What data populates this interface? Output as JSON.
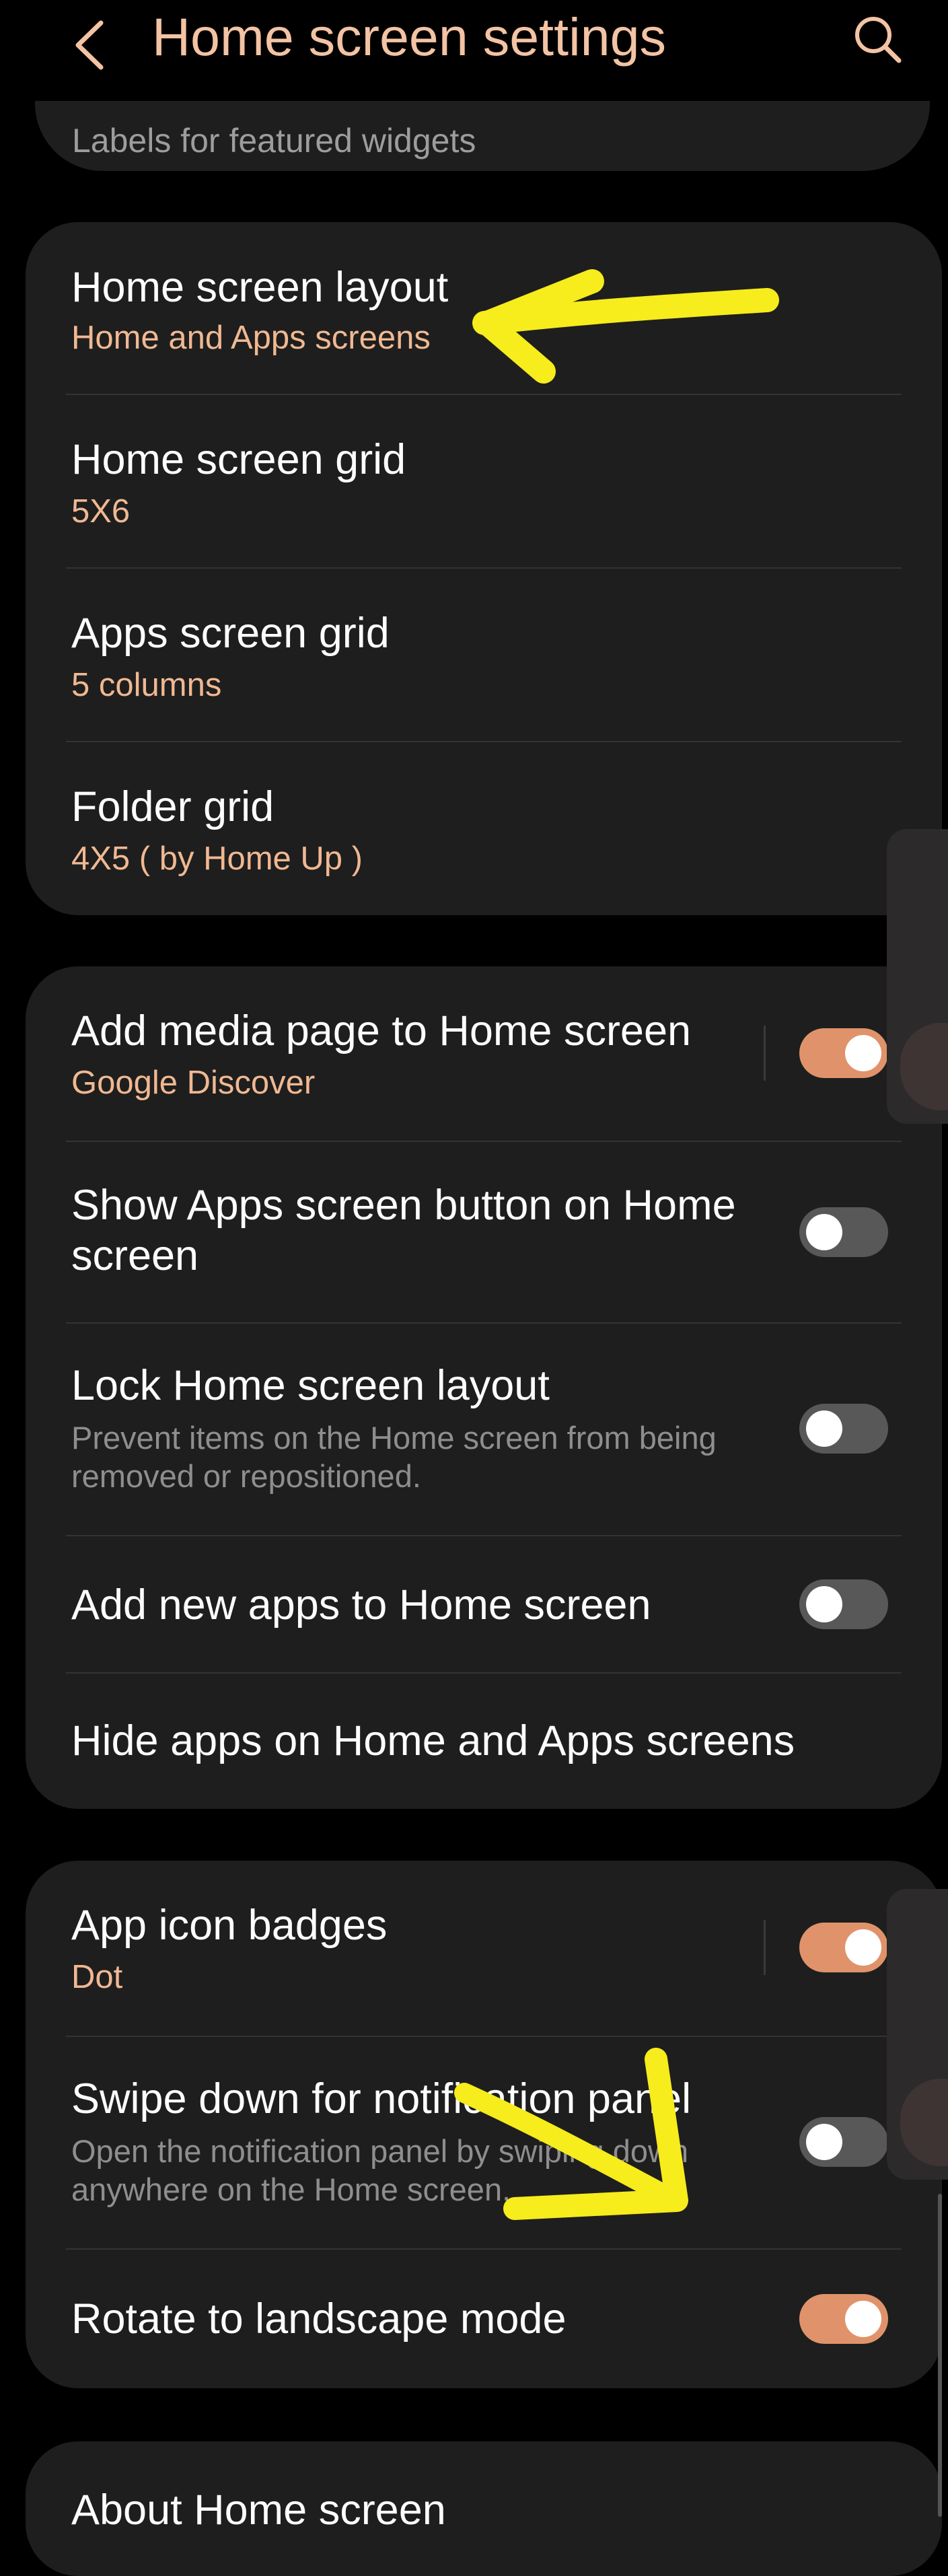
{
  "header": {
    "title": "Home screen settings",
    "back_icon": "chevron-left-icon",
    "search_icon": "search-icon"
  },
  "previous_card": {
    "label": "Labels for featured widgets"
  },
  "layout_group": {
    "home_layout": {
      "title": "Home screen layout",
      "value": "Home and Apps screens"
    },
    "home_grid": {
      "title": "Home screen grid",
      "value": "5X6"
    },
    "apps_grid": {
      "title": "Apps screen grid",
      "value": "5 columns"
    },
    "folder_grid": {
      "title": "Folder grid",
      "value": "4X5 ( by Home Up )"
    }
  },
  "options_group": {
    "media_page": {
      "title": "Add media page to Home screen",
      "value": "Google Discover",
      "enabled": true
    },
    "apps_button": {
      "title_line1": "Show Apps screen button on Home",
      "title_line2": "screen",
      "enabled": false
    },
    "lock_layout": {
      "title": "Lock Home screen layout",
      "desc": "Prevent items on the Home screen from being removed or repositioned.",
      "enabled": false
    },
    "add_new_apps": {
      "title": "Add new apps to Home screen",
      "enabled": false
    },
    "hide_apps": {
      "title": "Hide apps on Home and Apps screens"
    }
  },
  "misc_group": {
    "badges": {
      "title": "App icon badges",
      "value": "Dot",
      "enabled": true
    },
    "swipe_down": {
      "title": "Swipe down for notification panel",
      "desc": "Open the notification panel by swiping down anywhere on the Home screen.",
      "enabled": false
    },
    "rotate": {
      "title": "Rotate to landscape mode",
      "enabled": true
    }
  },
  "about": {
    "title": "About Home screen"
  },
  "annotations": {
    "color": "#f7ec1c"
  },
  "colors": {
    "background": "#000000",
    "card": "#1e1e1e",
    "accent": "#e0936a",
    "subtitle": "#f0b892",
    "title_text": "#f3c3a4"
  }
}
